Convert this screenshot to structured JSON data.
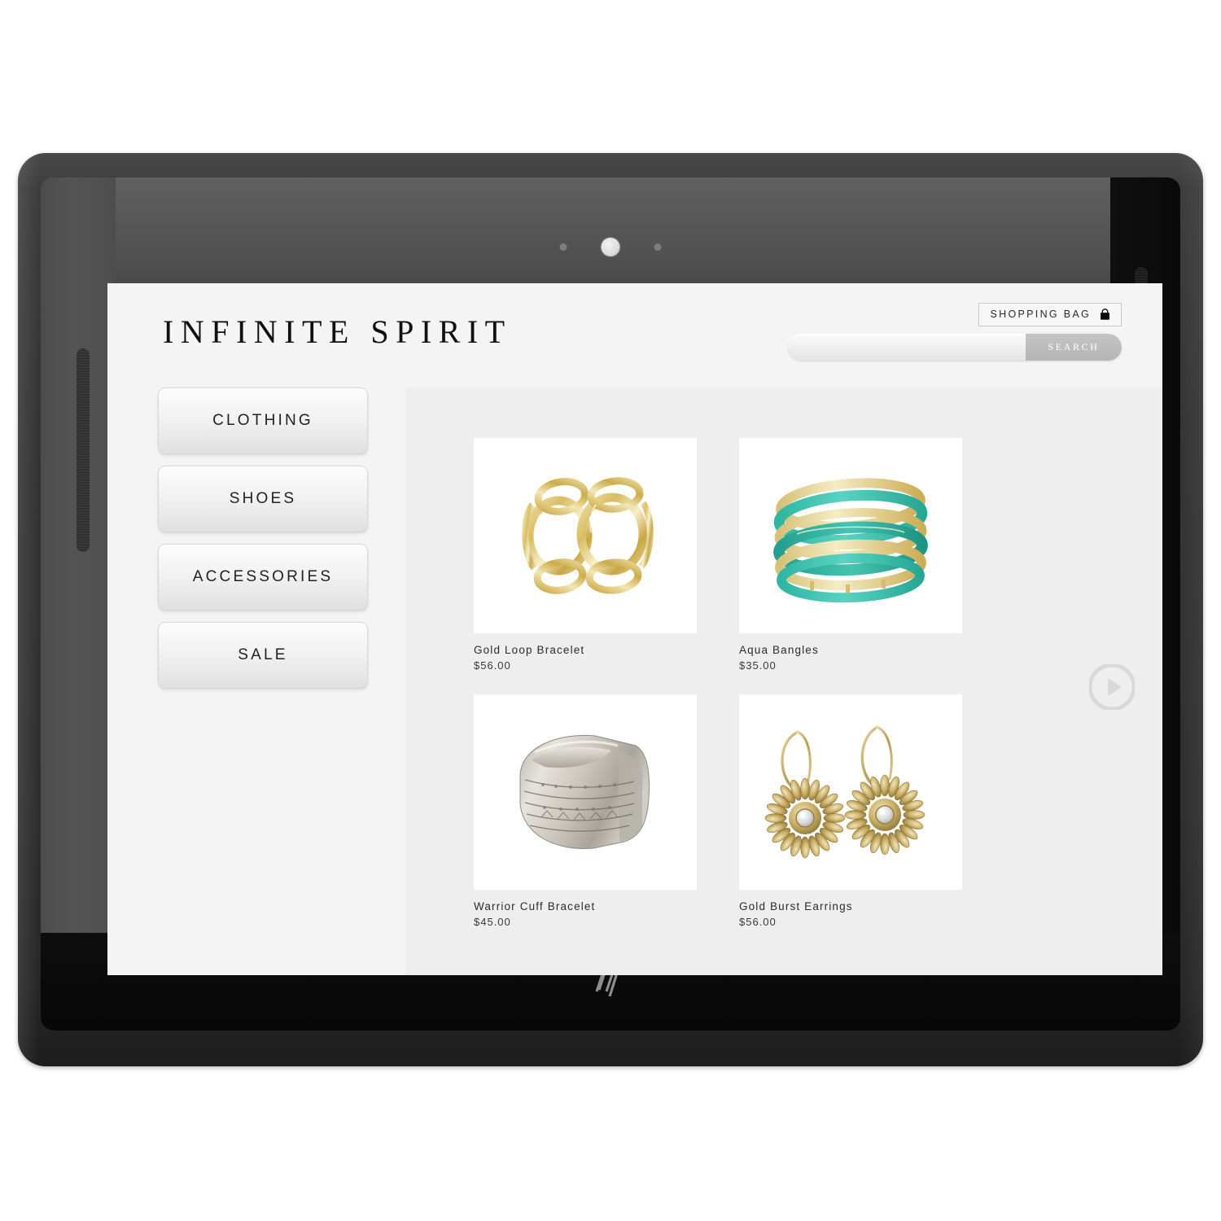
{
  "device": {
    "brand_logo": "hp",
    "camera_icon": "camera-lens"
  },
  "site": {
    "brand": "INFINITE SPIRIT"
  },
  "header": {
    "shopping_bag_label": "SHOPPING BAG",
    "shopping_bag_icon": "shopping-bag-icon",
    "search": {
      "value": "",
      "placeholder": "",
      "button_label": "SEARCH"
    }
  },
  "sidebar": {
    "items": [
      {
        "label": "CLOTHING"
      },
      {
        "label": "SHOES"
      },
      {
        "label": "ACCESSORIES"
      },
      {
        "label": "SALE"
      }
    ]
  },
  "main": {
    "next_label": "",
    "next_icon": "play-arrow-icon",
    "products": [
      {
        "name": "Gold Loop Bracelet",
        "price": "$56.00",
        "image": "gold-loop-bracelet"
      },
      {
        "name": "Aqua Bangles",
        "price": "$35.00",
        "image": "aqua-bangles"
      },
      {
        "name": "Warrior Cuff Bracelet",
        "price": "$45.00",
        "image": "warrior-cuff-bracelet"
      },
      {
        "name": "Gold Burst Earrings",
        "price": "$56.00",
        "image": "gold-burst-earrings"
      }
    ]
  },
  "colors": {
    "page_bg": "#f4f4f4",
    "panel_bg": "#eeeeee",
    "tile_bg": "#ffffff",
    "text": "#2c2c2c",
    "search_button": "#bdbdbd",
    "accent_aqua": "#3fc0b0",
    "accent_gold": "#c9a646"
  }
}
